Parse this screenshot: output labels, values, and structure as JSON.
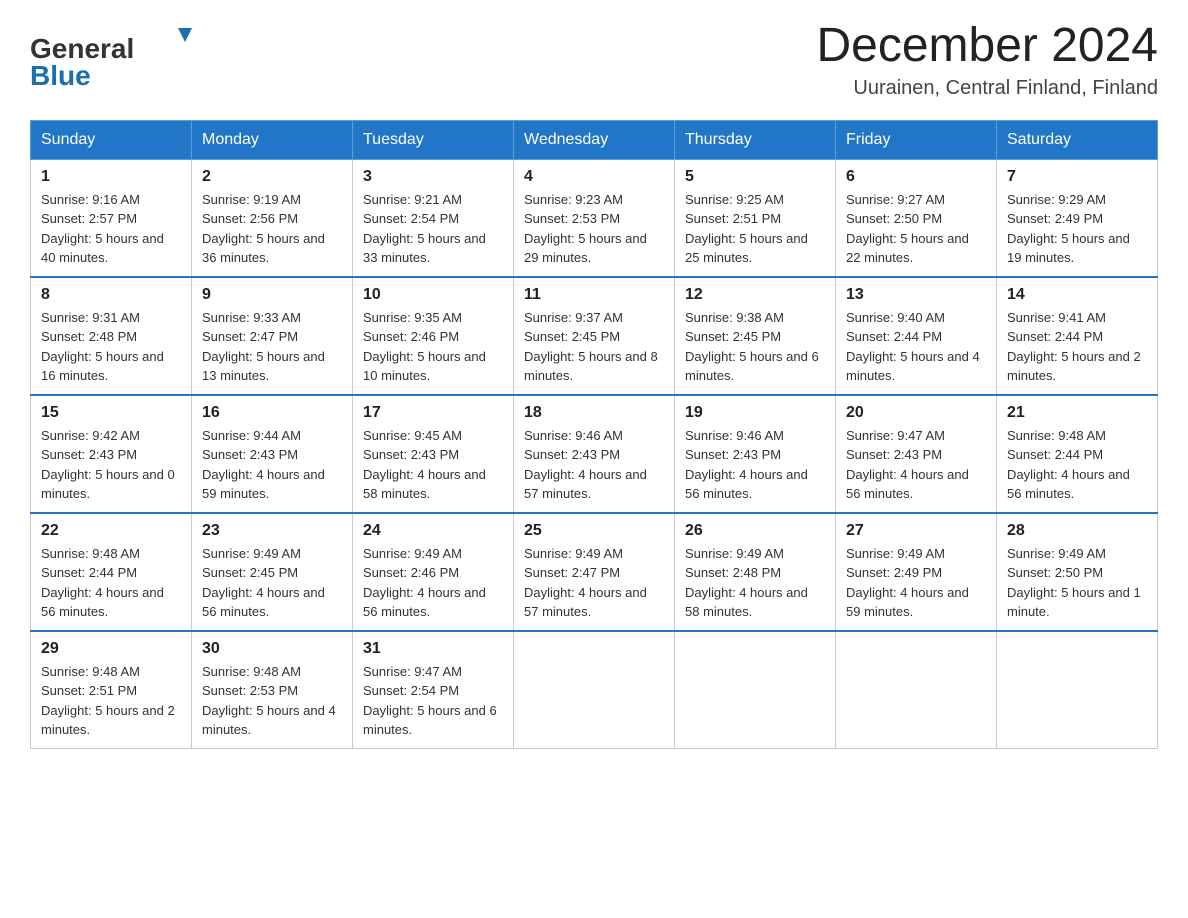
{
  "header": {
    "logo_general": "General",
    "logo_blue": "Blue",
    "month_title": "December 2024",
    "subtitle": "Uurainen, Central Finland, Finland"
  },
  "days_of_week": [
    "Sunday",
    "Monday",
    "Tuesday",
    "Wednesday",
    "Thursday",
    "Friday",
    "Saturday"
  ],
  "weeks": [
    [
      {
        "day": "1",
        "sunrise": "9:16 AM",
        "sunset": "2:57 PM",
        "daylight": "5 hours and 40 minutes."
      },
      {
        "day": "2",
        "sunrise": "9:19 AM",
        "sunset": "2:56 PM",
        "daylight": "5 hours and 36 minutes."
      },
      {
        "day": "3",
        "sunrise": "9:21 AM",
        "sunset": "2:54 PM",
        "daylight": "5 hours and 33 minutes."
      },
      {
        "day": "4",
        "sunrise": "9:23 AM",
        "sunset": "2:53 PM",
        "daylight": "5 hours and 29 minutes."
      },
      {
        "day": "5",
        "sunrise": "9:25 AM",
        "sunset": "2:51 PM",
        "daylight": "5 hours and 25 minutes."
      },
      {
        "day": "6",
        "sunrise": "9:27 AM",
        "sunset": "2:50 PM",
        "daylight": "5 hours and 22 minutes."
      },
      {
        "day": "7",
        "sunrise": "9:29 AM",
        "sunset": "2:49 PM",
        "daylight": "5 hours and 19 minutes."
      }
    ],
    [
      {
        "day": "8",
        "sunrise": "9:31 AM",
        "sunset": "2:48 PM",
        "daylight": "5 hours and 16 minutes."
      },
      {
        "day": "9",
        "sunrise": "9:33 AM",
        "sunset": "2:47 PM",
        "daylight": "5 hours and 13 minutes."
      },
      {
        "day": "10",
        "sunrise": "9:35 AM",
        "sunset": "2:46 PM",
        "daylight": "5 hours and 10 minutes."
      },
      {
        "day": "11",
        "sunrise": "9:37 AM",
        "sunset": "2:45 PM",
        "daylight": "5 hours and 8 minutes."
      },
      {
        "day": "12",
        "sunrise": "9:38 AM",
        "sunset": "2:45 PM",
        "daylight": "5 hours and 6 minutes."
      },
      {
        "day": "13",
        "sunrise": "9:40 AM",
        "sunset": "2:44 PM",
        "daylight": "5 hours and 4 minutes."
      },
      {
        "day": "14",
        "sunrise": "9:41 AM",
        "sunset": "2:44 PM",
        "daylight": "5 hours and 2 minutes."
      }
    ],
    [
      {
        "day": "15",
        "sunrise": "9:42 AM",
        "sunset": "2:43 PM",
        "daylight": "5 hours and 0 minutes."
      },
      {
        "day": "16",
        "sunrise": "9:44 AM",
        "sunset": "2:43 PM",
        "daylight": "4 hours and 59 minutes."
      },
      {
        "day": "17",
        "sunrise": "9:45 AM",
        "sunset": "2:43 PM",
        "daylight": "4 hours and 58 minutes."
      },
      {
        "day": "18",
        "sunrise": "9:46 AM",
        "sunset": "2:43 PM",
        "daylight": "4 hours and 57 minutes."
      },
      {
        "day": "19",
        "sunrise": "9:46 AM",
        "sunset": "2:43 PM",
        "daylight": "4 hours and 56 minutes."
      },
      {
        "day": "20",
        "sunrise": "9:47 AM",
        "sunset": "2:43 PM",
        "daylight": "4 hours and 56 minutes."
      },
      {
        "day": "21",
        "sunrise": "9:48 AM",
        "sunset": "2:44 PM",
        "daylight": "4 hours and 56 minutes."
      }
    ],
    [
      {
        "day": "22",
        "sunrise": "9:48 AM",
        "sunset": "2:44 PM",
        "daylight": "4 hours and 56 minutes."
      },
      {
        "day": "23",
        "sunrise": "9:49 AM",
        "sunset": "2:45 PM",
        "daylight": "4 hours and 56 minutes."
      },
      {
        "day": "24",
        "sunrise": "9:49 AM",
        "sunset": "2:46 PM",
        "daylight": "4 hours and 56 minutes."
      },
      {
        "day": "25",
        "sunrise": "9:49 AM",
        "sunset": "2:47 PM",
        "daylight": "4 hours and 57 minutes."
      },
      {
        "day": "26",
        "sunrise": "9:49 AM",
        "sunset": "2:48 PM",
        "daylight": "4 hours and 58 minutes."
      },
      {
        "day": "27",
        "sunrise": "9:49 AM",
        "sunset": "2:49 PM",
        "daylight": "4 hours and 59 minutes."
      },
      {
        "day": "28",
        "sunrise": "9:49 AM",
        "sunset": "2:50 PM",
        "daylight": "5 hours and 1 minute."
      }
    ],
    [
      {
        "day": "29",
        "sunrise": "9:48 AM",
        "sunset": "2:51 PM",
        "daylight": "5 hours and 2 minutes."
      },
      {
        "day": "30",
        "sunrise": "9:48 AM",
        "sunset": "2:53 PM",
        "daylight": "5 hours and 4 minutes."
      },
      {
        "day": "31",
        "sunrise": "9:47 AM",
        "sunset": "2:54 PM",
        "daylight": "5 hours and 6 minutes."
      },
      null,
      null,
      null,
      null
    ]
  ],
  "labels": {
    "sunrise": "Sunrise:",
    "sunset": "Sunset:",
    "daylight": "Daylight:"
  }
}
